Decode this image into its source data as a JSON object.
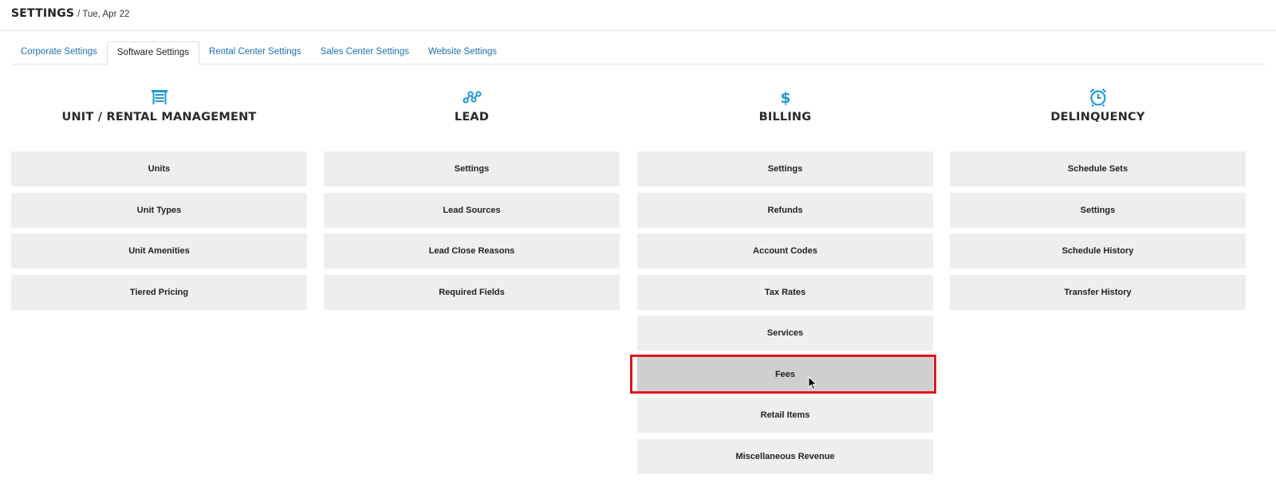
{
  "header": {
    "title": "SETTINGS",
    "date": " / Tue, Apr 22"
  },
  "tabs": [
    {
      "label": "Corporate Settings",
      "active": false
    },
    {
      "label": "Software Settings",
      "active": true
    },
    {
      "label": "Rental Center Settings",
      "active": false
    },
    {
      "label": "Sales Center Settings",
      "active": false
    },
    {
      "label": "Website Settings",
      "active": false
    }
  ],
  "colors": {
    "accent": "#1f9bd7",
    "link": "#1d6fb5",
    "highlight": "#e0151c",
    "button_bg": "#eeeeee",
    "button_hover": "#cfcfcf"
  },
  "columns": [
    {
      "icon": "garage-door-icon",
      "title": "UNIT / RENTAL MANAGEMENT",
      "items": [
        "Units",
        "Unit Types",
        "Unit Amenities",
        "Tiered Pricing"
      ]
    },
    {
      "icon": "network-nodes-icon",
      "title": "LEAD",
      "items": [
        "Settings",
        "Lead Sources",
        "Lead Close Reasons",
        "Required Fields"
      ]
    },
    {
      "icon": "dollar-icon",
      "title": "BILLING",
      "items": [
        "Settings",
        "Refunds",
        "Account Codes",
        "Tax Rates",
        "Services",
        "Fees",
        "Retail Items",
        "Miscellaneous Revenue"
      ]
    },
    {
      "icon": "alarm-clock-icon",
      "title": "DELINQUENCY",
      "items": [
        "Schedule Sets",
        "Settings",
        "Schedule History",
        "Transfer History"
      ]
    }
  ]
}
